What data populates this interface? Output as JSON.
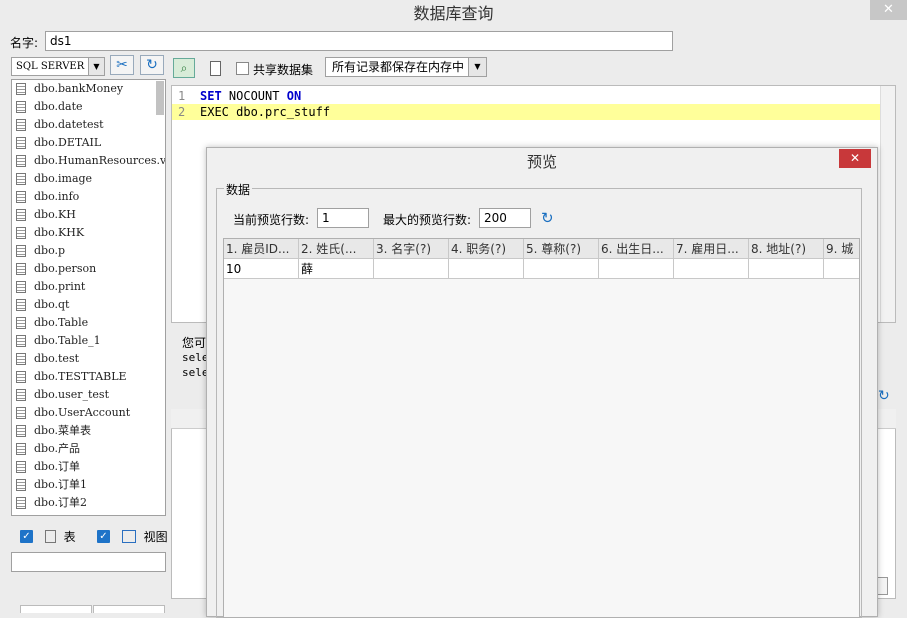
{
  "window": {
    "title": "数据库查询",
    "close_label": "✕"
  },
  "name_field": {
    "label": "名字:",
    "value": "ds1"
  },
  "toolbar": {
    "db_type": "SQL SERVER",
    "share_dataset_label": "共享数据集",
    "memory_option": "所有记录都保存在内存中"
  },
  "tree": {
    "items": [
      "dbo.bankMoney",
      "dbo.date",
      "dbo.datetest",
      "dbo.DETAIL",
      "dbo.HumanResources.vl",
      "dbo.image",
      "dbo.info",
      "dbo.KH",
      "dbo.KHK",
      "dbo.p",
      "dbo.person",
      "dbo.print",
      "dbo.qt",
      "dbo.Table",
      "dbo.Table_1",
      "dbo.test",
      "dbo.TESTTABLE",
      "dbo.user_test",
      "dbo.UserAccount",
      "dbo.菜单表",
      "dbo.产品",
      "dbo.订单",
      "dbo.订单1",
      "dbo.订单2"
    ]
  },
  "filters": {
    "table_label": "表",
    "view_label": "视图"
  },
  "editor": {
    "lines": [
      {
        "num": "1",
        "kw1": "SET",
        "text": " NOCOUNT ",
        "kw2": "ON"
      },
      {
        "num": "2",
        "text": "EXEC dbo.prc_stuff"
      }
    ]
  },
  "hint": {
    "line1": "您可",
    "line2": "sele",
    "line3": "sele"
  },
  "preview": {
    "title": "预览",
    "close_label": "✕",
    "group_label": "数据",
    "current_rows_label": "当前预览行数:",
    "current_rows_value": "1",
    "max_rows_label": "最大的预览行数:",
    "max_rows_value": "200",
    "columns": [
      "1. 雇员ID...",
      "2. 姓氏(...",
      "3. 名字(?)",
      "4. 职务(?)",
      "5. 尊称(?)",
      "6. 出生日...",
      "7. 雇用日...",
      "8. 地址(?)",
      "9. 城"
    ],
    "rows": [
      [
        "10",
        "薛",
        "",
        "",
        "",
        "",
        "",
        "",
        ""
      ]
    ]
  }
}
